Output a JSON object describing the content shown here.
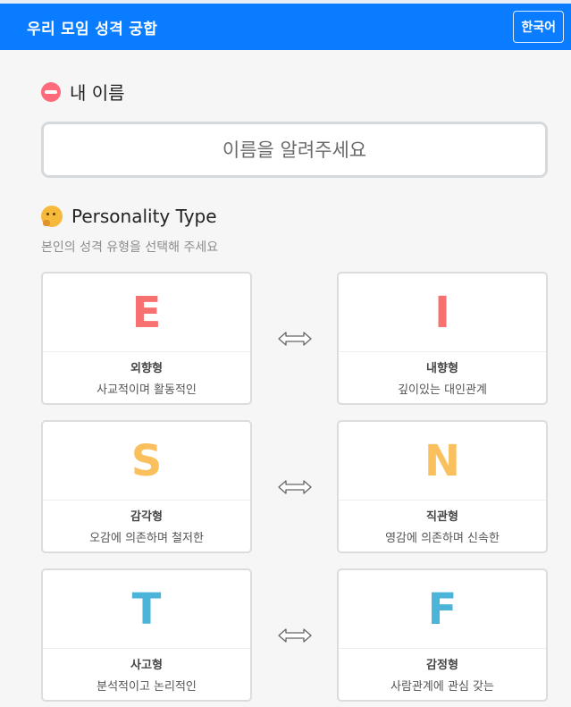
{
  "header": {
    "title": "우리 모임 성격 궁합",
    "lang_button": "한국어"
  },
  "name_section": {
    "heading": "내 이름",
    "icon": "lips-icon",
    "placeholder": "이름을 알려주세요",
    "value": ""
  },
  "personality_section": {
    "heading": "Personality Type",
    "icon": "thinking-face-icon",
    "subtitle": "본인의 성격 유형을 선택해 주세요"
  },
  "pairs": [
    {
      "left": {
        "letter": "E",
        "title": "외향형",
        "desc": "사교적이며 활동적인",
        "color": "#f87171"
      },
      "right": {
        "letter": "I",
        "title": "내향형",
        "desc": "깊이있는 대인관계",
        "color": "#f87171"
      }
    },
    {
      "left": {
        "letter": "S",
        "title": "감각형",
        "desc": "오감에 의존하며 철저한",
        "color": "#fac05e"
      },
      "right": {
        "letter": "N",
        "title": "직관형",
        "desc": "영감에 의존하며 신속한",
        "color": "#fac05e"
      }
    },
    {
      "left": {
        "letter": "T",
        "title": "사고형",
        "desc": "분석적이고 논리적인",
        "color": "#4bb4d8"
      },
      "right": {
        "letter": "F",
        "title": "감정형",
        "desc": "사람관계에 관심 갖는",
        "color": "#4bb4d8"
      }
    }
  ],
  "colors": {
    "header_bg": "#0a7cff",
    "page_bg": "#f6f6f6"
  }
}
